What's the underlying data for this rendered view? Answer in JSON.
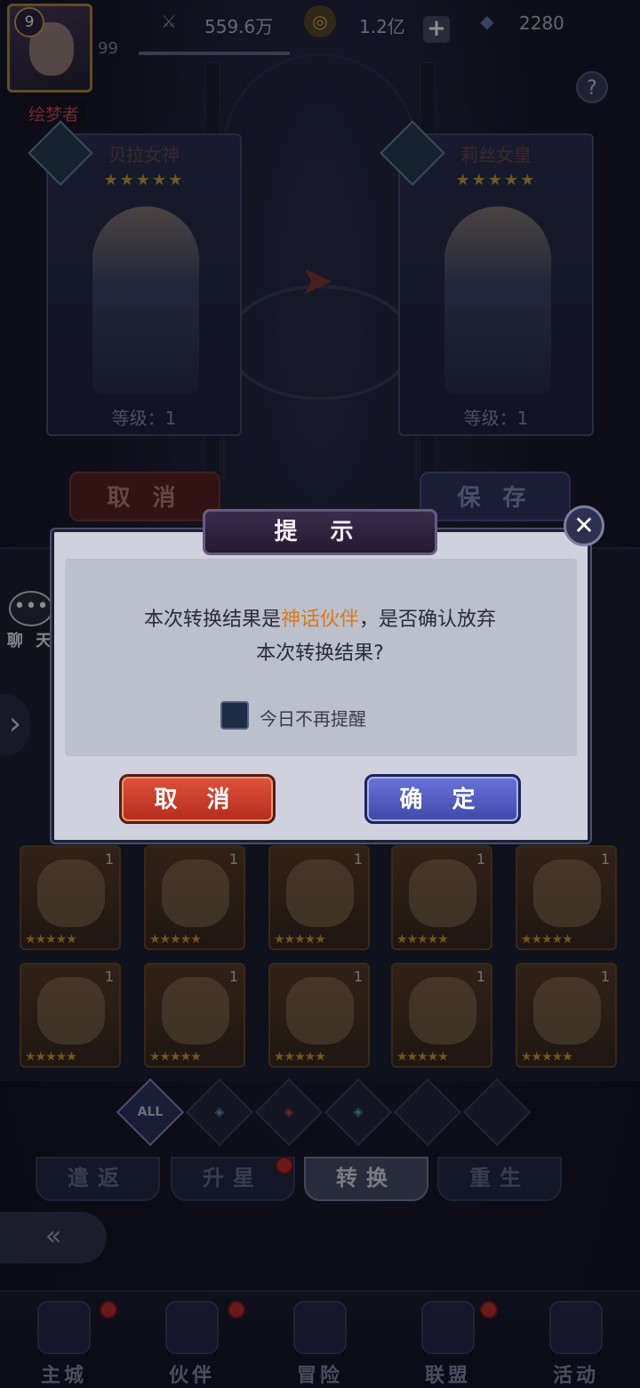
{
  "player": {
    "level": "9",
    "number": "99",
    "name": "绘梦者"
  },
  "resources": {
    "power": "559.6万",
    "gold": "1.2亿",
    "gems": "2280"
  },
  "help": {
    "label": "?"
  },
  "heroes": {
    "left": {
      "name": "贝拉女神",
      "stars": "★★★★★",
      "level": "等级：1"
    },
    "right": {
      "name": "莉丝女皇",
      "stars": "★★★★★",
      "level": "等级：1"
    }
  },
  "scene_buttons": {
    "cancel": "取 消",
    "save": "保 存"
  },
  "chat": {
    "label": "聊 天"
  },
  "dialog": {
    "title": "提 示",
    "close": "✕",
    "message_prefix": "本次转换结果是",
    "message_highlight": "神话伙伴",
    "message_suffix": "，是否确认放弃",
    "message_line2": "本次转换结果?",
    "checkbox_label": "今日不再提醒",
    "cancel": "取 消",
    "confirm": "确 定"
  },
  "grid": {
    "tiles": [
      {
        "num": "1",
        "stars": "★★★★★"
      },
      {
        "num": "1",
        "stars": "★★★★★"
      },
      {
        "num": "1",
        "stars": "★★★★★"
      },
      {
        "num": "1",
        "stars": "★★★★★"
      },
      {
        "num": "1",
        "stars": "★★★★★"
      },
      {
        "num": "1",
        "stars": "★★★★★"
      },
      {
        "num": "1",
        "stars": "★★★★★"
      },
      {
        "num": "1",
        "stars": "★★★★★"
      },
      {
        "num": "1",
        "stars": "★★★★★"
      },
      {
        "num": "1",
        "stars": "★★★★★"
      }
    ]
  },
  "filters": {
    "all": "ALL"
  },
  "func_tabs": [
    "遣返",
    "升星",
    "转换",
    "重生"
  ],
  "bottom_nav": [
    "主城",
    "伙伴",
    "冒险",
    "联盟",
    "活动"
  ],
  "colors": {
    "highlight": "#d77a1e",
    "cancel_red": "#c23a28",
    "confirm_blue": "#5058c0"
  }
}
